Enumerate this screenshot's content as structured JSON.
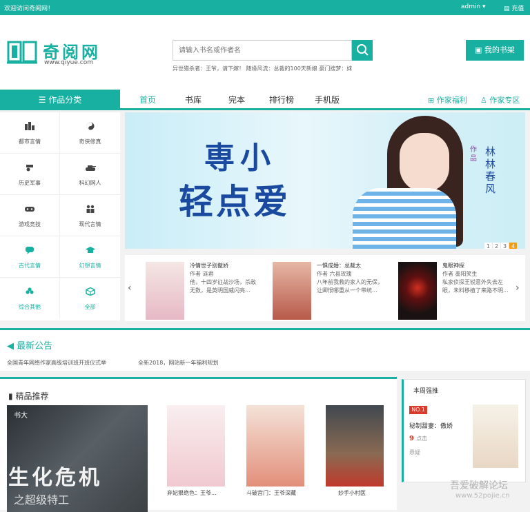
{
  "topbar": {
    "welcome": "欢迎访问奇阅网！",
    "user": "admin ▾",
    "recharge": "充值"
  },
  "header": {
    "logo_text": "奇阅网",
    "logo_sub": "www.qiyue.com",
    "search_placeholder": "请输入书名或作者名",
    "hot_words": "异世猎杀者：王爷，请下嫁！ 随缘风流：总裁的100天新娘 豪门搜梦：妹",
    "bookshelf": "我的书架"
  },
  "nav": {
    "category_header": "作品分类",
    "items": [
      "首页",
      "书库",
      "完本",
      "排行榜",
      "手机版"
    ],
    "right": [
      "作家福利",
      "作家专区"
    ]
  },
  "categories": [
    {
      "label": "都市言情",
      "icon": "city-icon"
    },
    {
      "label": "奇侠修真",
      "icon": "yinyang-icon"
    },
    {
      "label": "历史军事",
      "icon": "cannon-icon"
    },
    {
      "label": "科幻网人",
      "icon": "tank-icon"
    },
    {
      "label": "游戏竞技",
      "icon": "gamepad-icon"
    },
    {
      "label": "现代言情",
      "icon": "couple-icon"
    },
    {
      "label": "古代言情",
      "icon": "chat-icon"
    },
    {
      "label": "幻想言情",
      "icon": "graduation-icon"
    },
    {
      "label": "综合其他",
      "icon": "clover-icon"
    },
    {
      "label": "全部",
      "icon": "cube-icon"
    }
  ],
  "banner": {
    "title_line1": "専小",
    "title_line2": "轻点爱",
    "author_tag": "作品",
    "author_name": "林林春风",
    "pages": [
      "1",
      "2",
      "3",
      "4"
    ],
    "active_page": "4"
  },
  "carousel": [
    {
      "title": "冷情世子别傲娇",
      "author": "作者 涟君",
      "desc": "他，十四岁征战沙场，杀敌无数，是英明国威闪亮..."
    },
    {
      "title": "一惧成婚：总裁太",
      "author": "作者 六县玫瑰",
      "desc": "八年前我救的家人的无保，让卿恨哪重从一个带统..."
    },
    {
      "title": "鬼眼神探",
      "author": "作者 墨阳笑生",
      "desc": "私家侦探王锐意外失去左眼，未料移植了来路不明..."
    }
  ],
  "notice": {
    "title": "最新公告",
    "items": [
      "全国青年网络作家高级培训班开班仪式举",
      "全新2018，网站新一年福利规划"
    ]
  },
  "recommend": {
    "title": "精品推荐",
    "big_cover_title": "生化危机",
    "big_cover_sub": "之超级特工",
    "big_cover_logo": "书大",
    "books": [
      "弃妃狠绝色：王爷...",
      "斗破宫门：王爷深藏",
      "妙手小村医"
    ]
  },
  "weekly": {
    "title": "本周强推",
    "rank": "NO.1",
    "book": "秘制甜妻：傲娇",
    "count": "9",
    "count_unit": "点击",
    "tag": "悬疑"
  },
  "watermark": {
    "line1": "吾爱破解论坛",
    "line2": "www.52pojie.cn"
  },
  "colors": {
    "accent": "#18b0a0",
    "danger": "#d93a2b",
    "badge": "#f39c12"
  }
}
